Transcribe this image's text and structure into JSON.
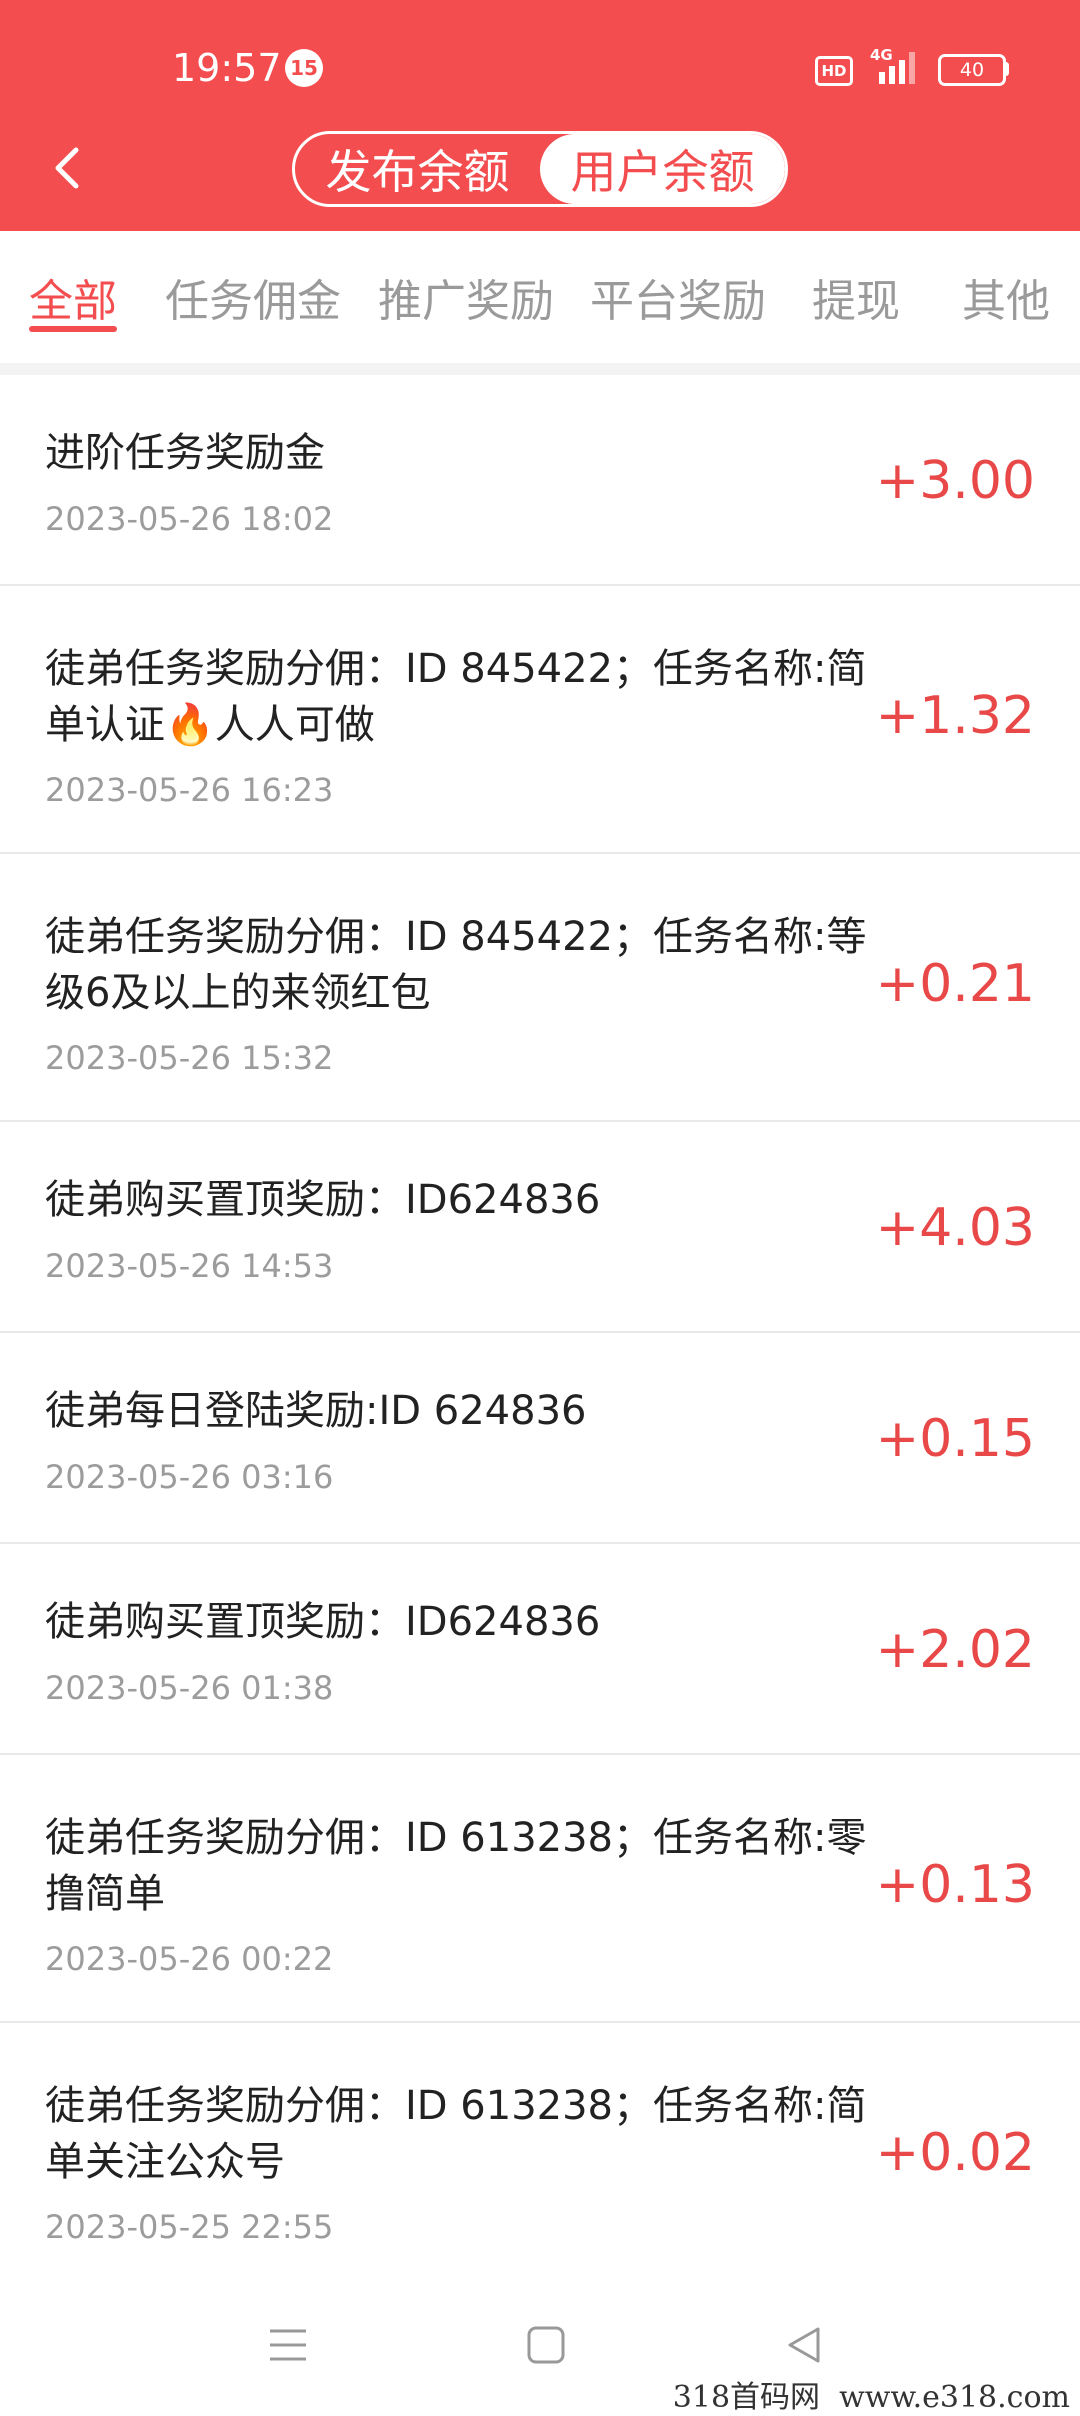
{
  "status_bar": {
    "time": "19:57",
    "notification_count": "15",
    "hd_label": "HD",
    "network": "4G",
    "battery": "40"
  },
  "header": {
    "segments": [
      "发布余额",
      "用户余额"
    ],
    "active_segment": 1
  },
  "tabs": [
    "全部",
    "任务佣金",
    "推广奖励",
    "平台奖励",
    "提现",
    "其他"
  ],
  "active_tab": 0,
  "records": [
    {
      "title": "进阶任务奖励金",
      "date": "2023-05-26 18:02",
      "amount": "+3.00"
    },
    {
      "title": "徒弟任务奖励分佣：ID 845422；任务名称:简单认证🔥人人可做",
      "date": "2023-05-26 16:23",
      "amount": "+1.32"
    },
    {
      "title": "徒弟任务奖励分佣：ID 845422；任务名称:等级6及以上的来领红包",
      "date": "2023-05-26 15:32",
      "amount": "+0.21"
    },
    {
      "title": "徒弟购买置顶奖励：ID624836",
      "date": "2023-05-26 14:53",
      "amount": "+4.03"
    },
    {
      "title": "徒弟每日登陆奖励:ID 624836",
      "date": "2023-05-26 03:16",
      "amount": "+0.15"
    },
    {
      "title": "徒弟购买置顶奖励：ID624836",
      "date": "2023-05-26 01:38",
      "amount": "+2.02"
    },
    {
      "title": "徒弟任务奖励分佣：ID 613238；任务名称:零撸简单",
      "date": "2023-05-26 00:22",
      "amount": "+0.13"
    },
    {
      "title": "徒弟任务奖励分佣：ID 613238；任务名称:简单关注公众号",
      "date": "2023-05-25 22:55",
      "amount": "+0.02"
    }
  ],
  "nav_icons": [
    "menu-icon",
    "home-square-icon",
    "back-triangle-icon"
  ],
  "watermark": "318首码网  www.e318.com",
  "colors": {
    "header_red": "#f34d4f",
    "amount_red": "#e94848",
    "tab_inactive": "#9a9a9a",
    "date_gray": "#9c9c9c"
  }
}
